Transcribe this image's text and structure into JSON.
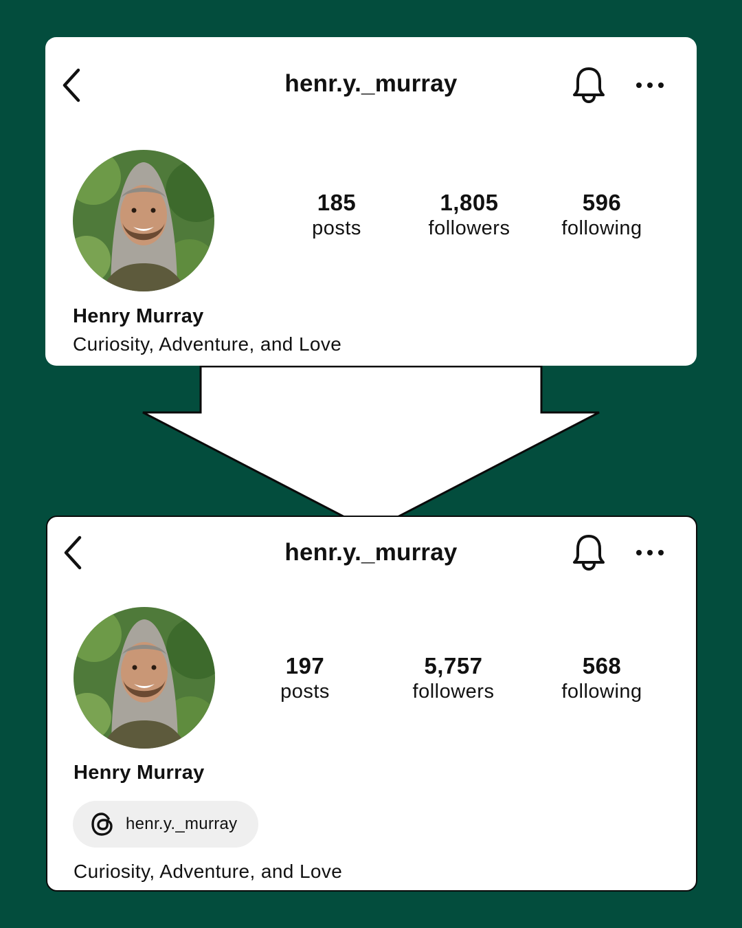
{
  "colors": {
    "background": "#034d3d",
    "card": "#ffffff",
    "chip": "#efefef"
  },
  "before": {
    "username": "henr.y._murray",
    "stats": [
      {
        "value": "185",
        "label": "posts"
      },
      {
        "value": "1,805",
        "label": "followers"
      },
      {
        "value": "596",
        "label": "following"
      }
    ],
    "name": "Henry Murray",
    "bio": "Curiosity, Adventure, and Love"
  },
  "after": {
    "username": "henr.y._murray",
    "stats": [
      {
        "value": "197",
        "label": "posts"
      },
      {
        "value": "5,757",
        "label": "followers"
      },
      {
        "value": "568",
        "label": "following"
      }
    ],
    "name": "Henry Murray",
    "threads_handle": "henr.y._murray",
    "bio": "Curiosity, Adventure, and Love"
  },
  "icons": [
    "back-chevron-icon",
    "bell-icon",
    "more-dots-icon",
    "threads-icon",
    "down-arrow"
  ]
}
